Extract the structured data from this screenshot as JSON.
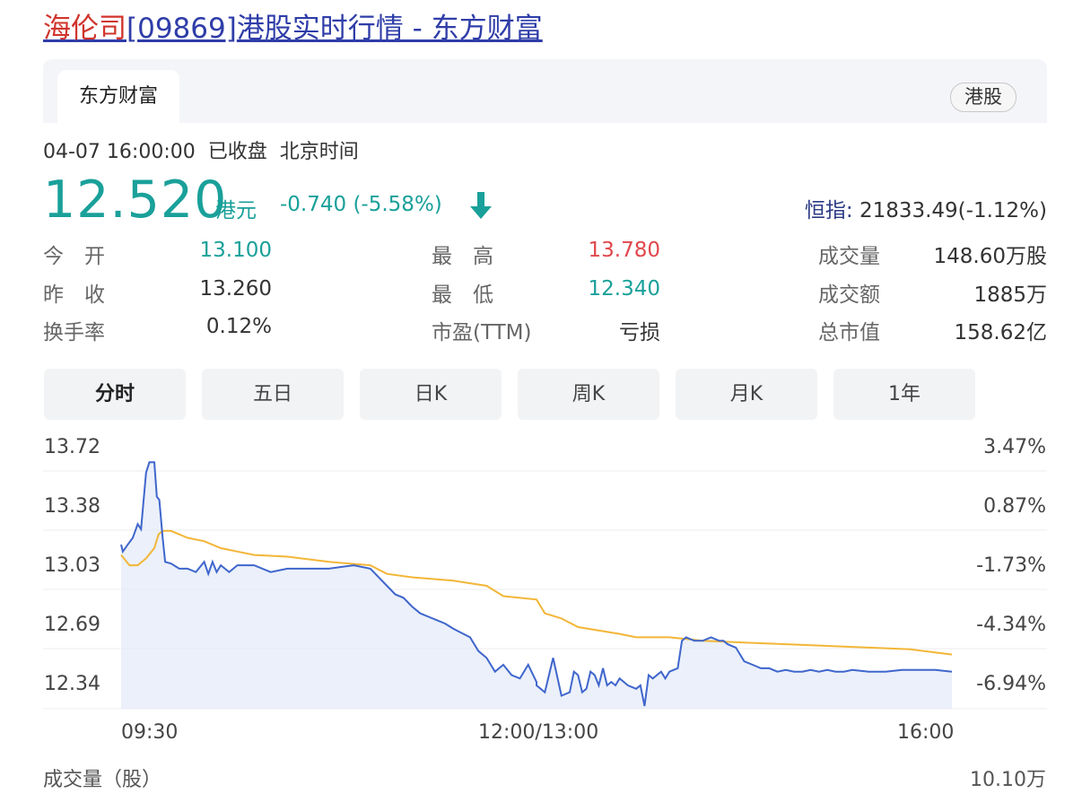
{
  "page_title": {
    "name": "海伦司",
    "code": "[09869]",
    "suffix": "港股实时行情 - 东方财富"
  },
  "tabs": {
    "active": "东方财富",
    "market_badge": "港股"
  },
  "quote": {
    "date": "04-07 16:00:00",
    "status": "已收盘",
    "timezone": "北京时间",
    "price": "12.520",
    "currency": "港元",
    "change": "-0.740 (-5.58%)",
    "direction": "down",
    "hsi_label": "恒指:",
    "hsi_value": "21833.49(-1.12%)"
  },
  "stats": {
    "open_label": "今　开",
    "open": "13.100",
    "prev_close_label": "昨　收",
    "prev_close": "13.260",
    "turnover_rate_label": "换手率",
    "turnover_rate": "0.12%",
    "high_label": "最　高",
    "high": "13.780",
    "low_label": "最　低",
    "low": "12.340",
    "pe_label": "市盈(TTM)",
    "pe": "亏损",
    "volume_label": "成交量",
    "volume": "148.60万股",
    "amount_label": "成交额",
    "amount": "1885万",
    "mkt_cap_label": "总市值",
    "mkt_cap": "158.62亿"
  },
  "period_tabs": [
    "分时",
    "五日",
    "日K",
    "周K",
    "月K",
    "1年"
  ],
  "chart_data": {
    "type": "line",
    "y_left_ticks": [
      "13.72",
      "13.38",
      "13.03",
      "12.69",
      "12.34"
    ],
    "y_right_ticks": [
      "3.47%",
      "0.87%",
      "-1.73%",
      "-4.34%",
      "-6.94%"
    ],
    "x_ticks": [
      "09:30",
      "12:00/13:00",
      "16:00"
    ],
    "ylim": [
      12.34,
      13.72
    ],
    "prev_close": 13.26,
    "volume_label": "成交量（股）",
    "volume_max": "10.10万",
    "colors": {
      "price": "#3f66cc",
      "avg": "#f2b637",
      "fill": "#e3e9f8"
    },
    "series": [
      {
        "x": [
          0,
          0.002,
          0.008,
          0.014,
          0.02,
          0.024,
          0.03,
          0.034,
          0.04,
          0.043,
          0.046,
          0.05,
          0.053,
          0.06,
          0.07,
          0.08,
          0.09,
          0.1,
          0.105,
          0.11,
          0.115,
          0.12,
          0.13,
          0.14,
          0.15,
          0.16,
          0.18,
          0.2,
          0.22,
          0.25,
          0.28,
          0.3,
          0.32,
          0.33,
          0.34,
          0.35,
          0.36,
          0.37,
          0.38,
          0.39,
          0.4,
          0.42,
          0.43,
          0.44,
          0.45,
          0.46,
          0.47,
          0.48,
          0.49,
          0.5,
          0.5,
          0.51,
          0.52,
          0.53,
          0.54,
          0.545,
          0.55,
          0.555,
          0.56,
          0.565,
          0.57,
          0.575,
          0.58,
          0.585,
          0.59,
          0.595,
          0.6,
          0.61,
          0.62,
          0.625,
          0.63,
          0.635,
          0.64,
          0.65,
          0.655,
          0.66,
          0.67,
          0.675,
          0.68,
          0.69,
          0.7,
          0.71,
          0.72,
          0.725,
          0.73,
          0.74,
          0.75,
          0.76,
          0.77,
          0.78,
          0.79,
          0.8,
          0.81,
          0.82,
          0.83,
          0.84,
          0.85,
          0.86,
          0.87,
          0.88,
          0.9,
          0.92,
          0.94,
          0.96,
          0.98,
          1.0
        ],
        "values": [
          13.16,
          13.12,
          13.16,
          13.2,
          13.28,
          13.25,
          13.58,
          13.64,
          13.64,
          13.44,
          13.42,
          13.2,
          13.06,
          13.05,
          13.02,
          13.02,
          13.0,
          13.06,
          12.99,
          13.06,
          13.0,
          13.04,
          13.0,
          13.04,
          13.04,
          13.04,
          13.0,
          13.02,
          13.02,
          13.02,
          13.04,
          13.02,
          12.92,
          12.87,
          12.85,
          12.8,
          12.76,
          12.74,
          12.72,
          12.7,
          12.67,
          12.62,
          12.54,
          12.5,
          12.42,
          12.46,
          12.4,
          12.38,
          12.46,
          12.36,
          12.34,
          12.3,
          12.5,
          12.28,
          12.3,
          12.42,
          12.4,
          12.3,
          12.32,
          12.42,
          12.4,
          12.34,
          12.44,
          12.34,
          12.36,
          12.34,
          12.38,
          12.34,
          12.32,
          12.34,
          12.22,
          12.4,
          12.38,
          12.42,
          12.38,
          12.42,
          12.44,
          12.6,
          12.62,
          12.6,
          12.6,
          12.62,
          12.6,
          12.6,
          12.58,
          12.56,
          12.48,
          12.46,
          12.44,
          12.44,
          12.42,
          12.43,
          12.42,
          12.42,
          12.43,
          12.42,
          12.43,
          12.42,
          12.42,
          12.43,
          12.42,
          12.42,
          12.43,
          12.43,
          12.43,
          12.42
        ]
      },
      {
        "x": [
          0,
          0.01,
          0.02,
          0.03,
          0.04,
          0.045,
          0.05,
          0.06,
          0.08,
          0.1,
          0.12,
          0.14,
          0.16,
          0.2,
          0.25,
          0.3,
          0.32,
          0.35,
          0.4,
          0.44,
          0.46,
          0.5,
          0.5,
          0.51,
          0.53,
          0.55,
          0.6,
          0.62,
          0.64,
          0.66,
          0.68,
          0.7,
          0.75,
          0.8,
          0.85,
          0.9,
          0.95,
          1.0
        ],
        "values": [
          13.1,
          13.04,
          13.04,
          13.08,
          13.14,
          13.22,
          13.24,
          13.24,
          13.2,
          13.18,
          13.14,
          13.12,
          13.1,
          13.09,
          13.06,
          13.04,
          12.99,
          12.97,
          12.95,
          12.92,
          12.86,
          12.84,
          12.84,
          12.76,
          12.73,
          12.68,
          12.64,
          12.62,
          12.62,
          12.62,
          12.61,
          12.6,
          12.59,
          12.58,
          12.57,
          12.56,
          12.55,
          12.52
        ]
      }
    ]
  }
}
